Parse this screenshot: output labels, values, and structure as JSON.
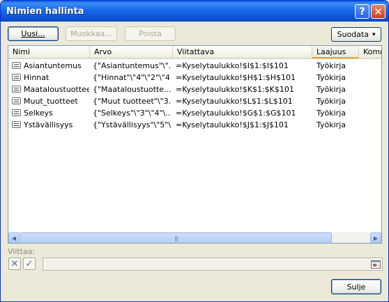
{
  "window": {
    "title": "Nimien hallinta",
    "help_glyph": "?",
    "close_glyph": "✕"
  },
  "toolbar": {
    "new_label": "Uusi...",
    "edit_label": "Muokkaa...",
    "delete_label": "Poista",
    "filter_label": "Suodata",
    "filter_arrow": "▾"
  },
  "list": {
    "columns": [
      "Nimi",
      "Arvo",
      "Viitattava",
      "Laajuus",
      "Kommentti"
    ],
    "sorted_column": "Laajuus",
    "rows": [
      {
        "name": "Asiantuntemus",
        "value": "{\"Asiantuntemus\"\\\"...",
        "ref": "=Kyselytaulukko!$I$1:$I$101",
        "scope": "Työkirja"
      },
      {
        "name": "Hinnat",
        "value": "{\"Hinnat\"\\\"4\"\\\"2\"\\\"4...",
        "ref": "=Kyselytaulukko!$H$1:$H$101",
        "scope": "Työkirja"
      },
      {
        "name": "Maataloustuotteet",
        "value": "{\"Maataloustuotte...",
        "ref": "=Kyselytaulukko!$K$1:$K$101",
        "scope": "Työkirja"
      },
      {
        "name": "Muut_tuotteet",
        "value": "{\"Muut tuotteet\"\\\"3...",
        "ref": "=Kyselytaulukko!$L$1:$L$101",
        "scope": "Työkirja"
      },
      {
        "name": "Selkeys",
        "value": "{\"Selkeys\"\\\"3\"\\\"4\"\\...",
        "ref": "=Kyselytaulukko!$G$1:$G$101",
        "scope": "Työkirja"
      },
      {
        "name": "Ystävällisyys",
        "value": "{\"Ystävällisyys\"\\\"5\"\\...",
        "ref": "=Kyselytaulukko!$J$1:$J$101",
        "scope": "Työkirja"
      }
    ],
    "scroll_left_glyph": "◀",
    "scroll_right_glyph": "▶",
    "scroll_grip": "|||"
  },
  "reference": {
    "label": "Viittaa:",
    "cancel_glyph": "✕",
    "accept_glyph": "✓",
    "value": ""
  },
  "footer": {
    "close_label": "Sulje"
  },
  "colors": {
    "title_blue": "#0d55d8",
    "sort_accent": "#f0a020"
  }
}
